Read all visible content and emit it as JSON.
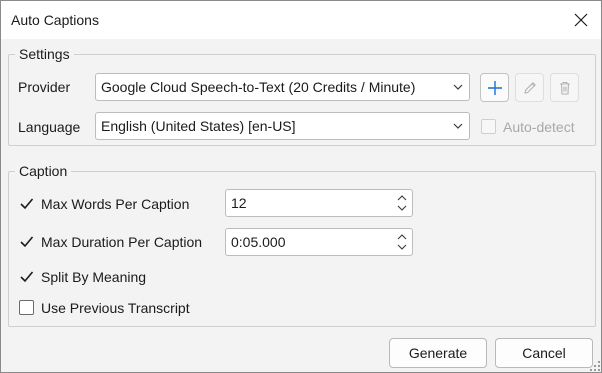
{
  "window": {
    "title": "Auto Captions"
  },
  "settings": {
    "legend": "Settings",
    "provider_label": "Provider",
    "provider_value": "Google Cloud Speech-to-Text (20 Credits / Minute)",
    "language_label": "Language",
    "language_value": "English (United States) [en-US]",
    "auto_detect_label": "Auto-detect",
    "auto_detect_checked": false,
    "auto_detect_enabled": false
  },
  "caption": {
    "legend": "Caption",
    "max_words": {
      "label": "Max Words Per Caption",
      "checked": true,
      "value": "12"
    },
    "max_duration": {
      "label": "Max Duration Per Caption",
      "checked": true,
      "value": "0:05.000"
    },
    "split_by_meaning": {
      "label": "Split By Meaning",
      "checked": true
    },
    "use_previous": {
      "label": "Use Previous Transcript",
      "checked": false
    }
  },
  "buttons": {
    "generate": "Generate",
    "cancel": "Cancel"
  },
  "icons": {
    "close": "close-icon",
    "add": "plus-icon",
    "edit": "pencil-icon",
    "delete": "trash-icon",
    "dropdown": "chevron-down-icon",
    "spinner": "spin-arrows-icon",
    "resize": "resize-grip-icon"
  },
  "colors": {
    "accent": "#1a6fd1",
    "disabled": "#b4b4b4",
    "text": "#1b1b1b",
    "background": "#f3f3f3"
  }
}
